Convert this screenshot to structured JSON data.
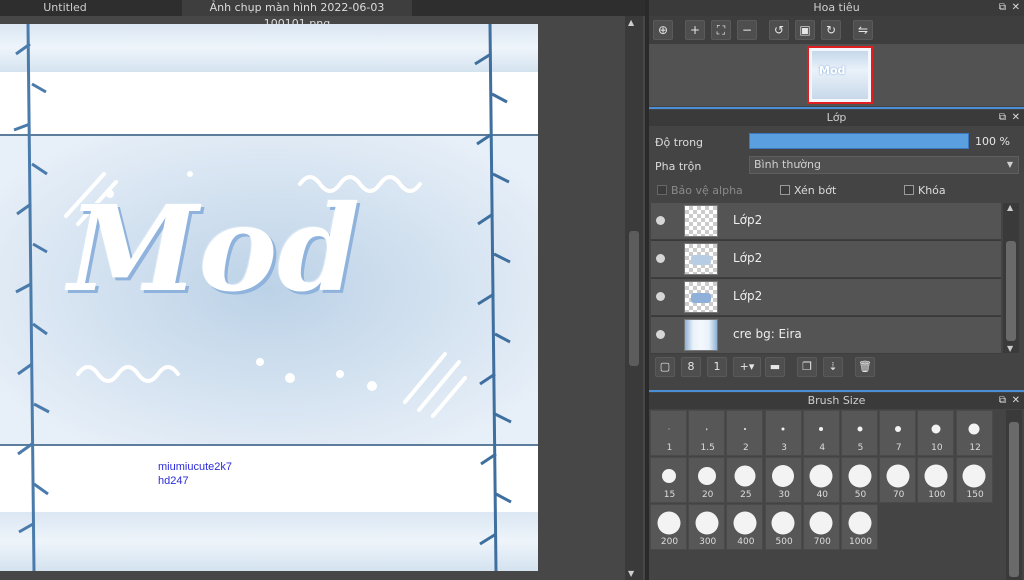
{
  "tabs": {
    "tab1": "Untitled",
    "tab2": "Ảnh chụp màn hình 2022-06-03 100101.png"
  },
  "canvas": {
    "headline": "Mod",
    "credit_line1": "miumiucute2k7",
    "credit_line2": "hd247",
    "accent_color": "#7aa4d4",
    "frame_color": "#4a7bab"
  },
  "navigator": {
    "title": "Hoa tiêu",
    "thumb_text": "Mod",
    "tools": [
      "zoom-in-icon",
      "zoom-fit-icon",
      "zoom-out-icon",
      "rotate-left-icon",
      "reset-icon",
      "rotate-right-icon",
      "flip-icon"
    ]
  },
  "layer_panel": {
    "title": "Lớp",
    "opacity_label": "Độ trong",
    "opacity_value": "100 %",
    "opacity_fraction": 1.0,
    "blend_label": "Pha trộn",
    "blend_value": "Bình thường",
    "protect_alpha": "Bảo vệ alpha",
    "clipping": "Xén bớt",
    "lock": "Khóa",
    "layers": [
      {
        "name": "Lớp2"
      },
      {
        "name": "Lớp2"
      },
      {
        "name": "Lớp2"
      },
      {
        "name": "cre bg: Eira"
      }
    ]
  },
  "brush_panel": {
    "title": "Brush Size",
    "sizes": [
      "1",
      "1.5",
      "2",
      "3",
      "4",
      "5",
      "7",
      "10",
      "12",
      "15",
      "20",
      "25",
      "30",
      "40",
      "50",
      "70",
      "100",
      "150",
      "200",
      "300",
      "400",
      "500",
      "700",
      "1000"
    ]
  }
}
